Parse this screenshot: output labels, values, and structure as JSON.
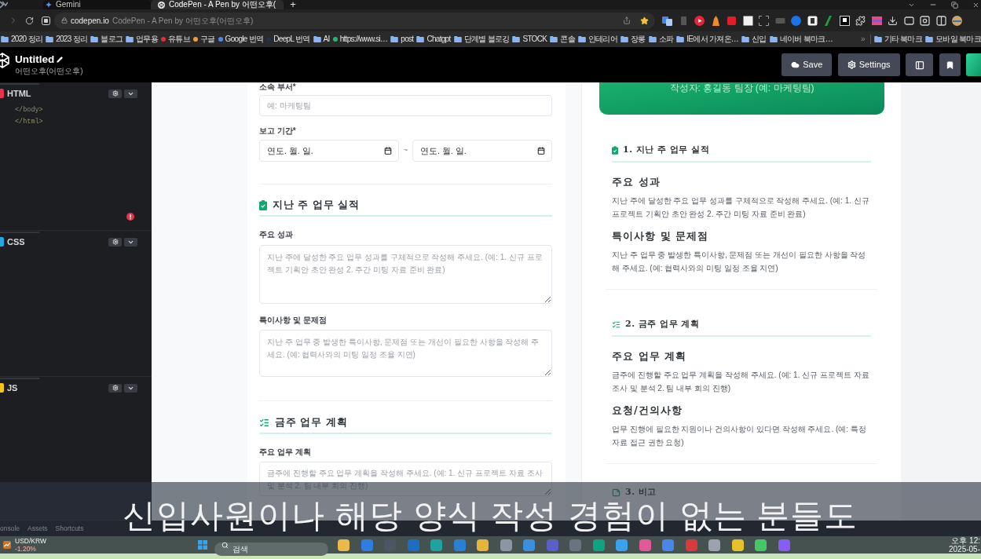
{
  "browser": {
    "tabs": [
      {
        "kind": "gemini",
        "label": "Gemini",
        "selected": false
      },
      {
        "kind": "codepen",
        "label": "CodePen - A Pen by 어떤오후(",
        "selected": true
      }
    ],
    "new_tab": "+",
    "address": {
      "domain": "codepen.io",
      "page_title": "CodePen - A Pen by 어떤오후(어떤오후)"
    },
    "bookmarks": [
      {
        "kind": "folder",
        "label": "2020 정리"
      },
      {
        "kind": "folder",
        "label": "2023 정리"
      },
      {
        "kind": "folder",
        "label": "블로그"
      },
      {
        "kind": "folder",
        "label": "업무용"
      },
      {
        "kind": "site",
        "label": "유튜브",
        "color": "#e52d3a"
      },
      {
        "kind": "site",
        "label": "구글",
        "color": "#f39c34"
      },
      {
        "kind": "site",
        "label": "Google 번역",
        "color": "#4f86e8"
      },
      {
        "kind": "site",
        "label": "DeepL 번역",
        "color": "#24324a"
      },
      {
        "kind": "folder",
        "label": "AI"
      },
      {
        "kind": "site",
        "label": "https://www.si…",
        "color": "#22b573"
      },
      {
        "kind": "folder",
        "label": "post"
      },
      {
        "kind": "folder",
        "label": "Chatgpt"
      },
      {
        "kind": "folder",
        "label": "단계별 블로깅"
      },
      {
        "kind": "folder",
        "label": "STOCK"
      },
      {
        "kind": "folder",
        "label": "콘솔"
      },
      {
        "kind": "folder",
        "label": "인테리어"
      },
      {
        "kind": "folder",
        "label": "장롱"
      },
      {
        "kind": "folder",
        "label": "소파"
      },
      {
        "kind": "folder",
        "label": "IE에서 가져온…"
      },
      {
        "kind": "folder",
        "label": "신입"
      },
      {
        "kind": "folder",
        "label": "네이버 북마크…"
      }
    ],
    "more_bookmarks": "»",
    "other_bookmarks": [
      {
        "kind": "folder",
        "label": "기타 북마크"
      },
      {
        "kind": "folder",
        "label": "모바일 북마크"
      }
    ]
  },
  "pen_header": {
    "title": "Untitled",
    "author": "어떤오후(어떤오후)",
    "buttons": [
      {
        "kind": "save",
        "label": "Save"
      },
      {
        "kind": "settings",
        "label": "Settings"
      }
    ]
  },
  "editor": {
    "panels": [
      {
        "label": "HTML",
        "color": "#e8334a",
        "lines": [
          "</body>",
          "</html>"
        ],
        "error": true
      },
      {
        "label": "CSS",
        "color": "#27a7e0",
        "error": false
      },
      {
        "label": "JS",
        "color": "#f5c518",
        "error": false
      }
    ],
    "footer_tabs": [
      "onsole",
      "Assets",
      "Shortcuts"
    ]
  },
  "form": {
    "department": {
      "label": "소속 부서*",
      "placeholder": "예: 마케팅팀"
    },
    "period": {
      "label": "보고 기간*",
      "dates": [
        {
          "placeholder": "연도. 월. 일."
        },
        {
          "placeholder": "연도. 월. 일."
        }
      ],
      "separator": "~"
    },
    "sections": [
      {
        "kind": "check",
        "title": "지난 주 업무 실적",
        "fields": [
          {
            "label": "주요 성과",
            "placeholder": "지난 주에 달성한 주요 업무 성과를 구체적으로 작성해 주세요. (예: 1. 신규 프로젝트 기획안 초안 완성 2. 주간 미팅 자료 준비 완료)"
          },
          {
            "label": "특이사항 및 문제점",
            "placeholder": "지난 주 업무 중 발생한 특이사항, 문제점 또는 개선이 필요한 사항을 작성해 주세요. (예: 협력사와의 미팅 일정 조율 지연)"
          }
        ]
      },
      {
        "kind": "list",
        "title": "금주 업무 계획",
        "fields": [
          {
            "label": "주요 업무 계획",
            "placeholder": "금주에 진행할 주요 업무 계획을 작성해 주세요. (예: 1. 신규 프로젝트 자료 조사 및 분석 2. 팀 내부 회의 진행)"
          }
        ]
      }
    ]
  },
  "preview": {
    "header": {
      "author_line": "작성자: 홍길동 팀장 (예: 마케팅팀)"
    },
    "sections": [
      {
        "kind": "check",
        "title": "1. 지난 주 업무 실적",
        "items": [
          {
            "heading": "주요 성과",
            "text": "지난 주에 달성한 주요 업무 성과를 구체적으로 작성해 주세요. (예: 1. 신규 프로젝트 기획안 초안 완성 2. 주간 미팅 자료 준비 완료)"
          },
          {
            "heading": "특이사항 및 문제점",
            "text": "지난 주 업무 중 발생한 특이사항, 문제점 또는 개선이 필요한 사항을 작성해 주세요. (예: 협력사와의 미팅 일정 조율 지연)"
          }
        ]
      },
      {
        "kind": "list",
        "title": "2. 금주 업무 계획",
        "items": [
          {
            "heading": "주요 업무 계획",
            "text": "금주에 진행할 주요 업무 계획을 작성해 주세요. (예: 1. 신규 프로젝트 자료 조사 및 분석 2. 팀 내부 회의 진행)"
          },
          {
            "heading": "요청/건의사항",
            "text": "업무 진행에 필요한 지원이나 건의사항이 있다면 작성해 주세요. (예: 특정 자료 접근 권한 요청)"
          }
        ]
      },
      {
        "kind": "note",
        "title": "3. 비고"
      }
    ]
  },
  "caption": "신입사원이나 해당 양식 작성 경험이 없는 분들도",
  "taskbar": {
    "ticker": {
      "symbol": "USD/KRW",
      "change": "-1.20%"
    },
    "search": {
      "placeholder": "검색"
    },
    "clock": {
      "time": "오후 12:",
      "date": "2025-05-"
    }
  }
}
